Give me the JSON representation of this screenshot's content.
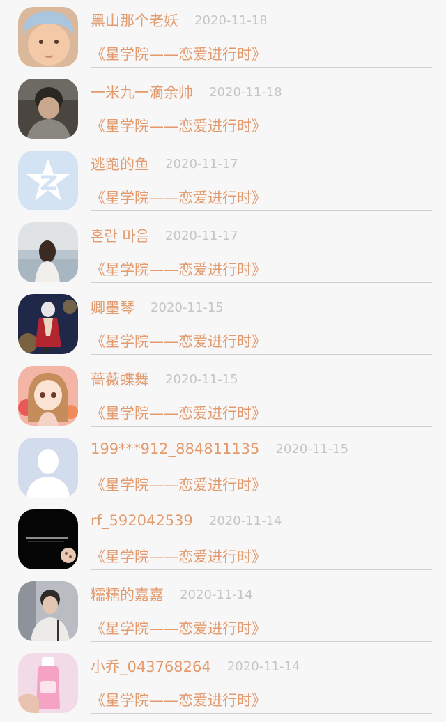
{
  "comments": [
    {
      "user": "黑山那个老妖",
      "date": "2020-11-18",
      "work": "《星学院——恋爱进行时》",
      "avatar": "baby-avatar"
    },
    {
      "user": "一米九一滴余帅",
      "date": "2020-11-18",
      "work": "《星学院——恋爱进行时》",
      "avatar": "child-photo-avatar"
    },
    {
      "user": "逃跑的鱼",
      "date": "2020-11-17",
      "work": "《星学院——恋爱进行时》",
      "avatar": "qq-star-avatar"
    },
    {
      "user": "혼란 마음",
      "date": "2020-11-17",
      "work": "《星学院——恋爱进行时》",
      "avatar": "girl-sea-avatar"
    },
    {
      "user": "卿墨琴",
      "date": "2020-11-15",
      "work": "《星学院——恋爱进行时》",
      "avatar": "anime-warrior-avatar"
    },
    {
      "user": "蔷薇蝶舞",
      "date": "2020-11-15",
      "work": "《星学院——恋爱进行时》",
      "avatar": "anime-girl-avatar"
    },
    {
      "user": "199***912_884811135",
      "date": "2020-11-15",
      "work": "《星学院——恋爱进行时》",
      "avatar": "default-person-avatar"
    },
    {
      "user": "rf_592042539",
      "date": "2020-11-14",
      "work": "《星学院——恋爱进行时》",
      "avatar": "dark-text-avatar"
    },
    {
      "user": "糯糯的嘉嘉",
      "date": "2020-11-14",
      "work": "《星学院——恋爱进行时》",
      "avatar": "boy-photo-avatar"
    },
    {
      "user": "小乔_043768264",
      "date": "2020-11-14",
      "work": "《星学院——恋爱进行时》",
      "avatar": "pink-bottle-avatar"
    }
  ]
}
